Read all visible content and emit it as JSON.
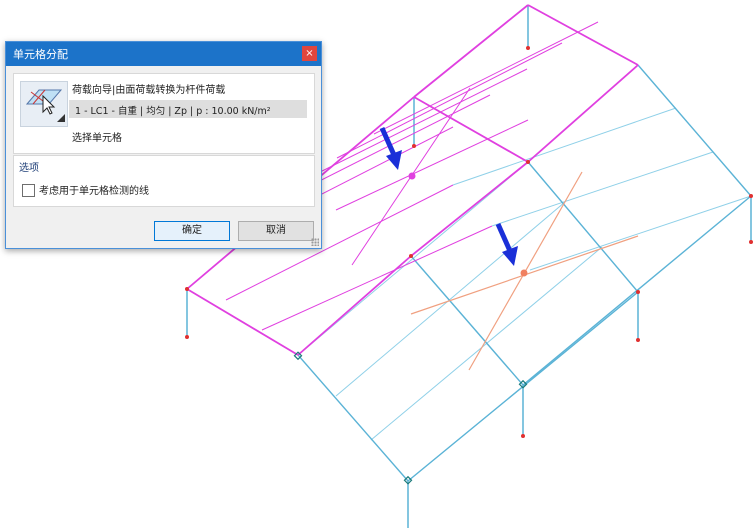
{
  "dialog": {
    "title": "单元格分配",
    "close_glyph": "×",
    "wizard_label": "荷载向导|由面荷载转换为杆件荷载",
    "load_case": "1 - LC1 - 自重 | 均匀 | Zp | p : 10.00 kN/m²",
    "select_cells": "选择单元格",
    "options_title": "选项",
    "option_checkbox_label": "考虑用于单元格检测的线",
    "option_checked": false,
    "ok_label": "确定",
    "cancel_label": "取消"
  },
  "colors": {
    "selected_members": "#e040e0",
    "unselected_members": "#8fd0e8",
    "columns": "#5bb3d6",
    "loaded_cell_lines": "#f0a080",
    "node_markers": "#e03030",
    "arrows": "#1a2fd8",
    "titlebar": "#1c73c9"
  }
}
